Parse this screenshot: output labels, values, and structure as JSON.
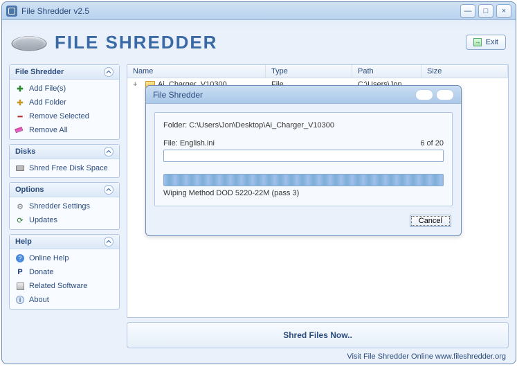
{
  "window": {
    "title": "File Shredder v2.5"
  },
  "header": {
    "logo_text": "FILE SHREDDER",
    "exit_label": "Exit"
  },
  "titlecontrols": {
    "min": "—",
    "max": "□",
    "close": "×"
  },
  "sidebar": {
    "sections": [
      {
        "title": "File Shredder",
        "items": [
          "Add File(s)",
          "Add Folder",
          "Remove Selected",
          "Remove All"
        ]
      },
      {
        "title": "Disks",
        "items": [
          "Shred Free Disk Space"
        ]
      },
      {
        "title": "Options",
        "items": [
          "Shredder Settings",
          "Updates"
        ]
      },
      {
        "title": "Help",
        "items": [
          "Online Help",
          "Donate",
          "Related Software",
          "About"
        ]
      }
    ]
  },
  "list": {
    "headers": {
      "name": "Name",
      "type": "Type",
      "path": "Path",
      "size": "Size"
    },
    "rows": [
      {
        "expand": "+",
        "name": "Ai_Charger_V10300",
        "type": "File",
        "path": "C:\\Users\\Jon",
        "size": ""
      }
    ]
  },
  "shred_button": "Shred Files Now..",
  "footer": "Visit File Shredder Online   www.fileshredder.org",
  "dialog": {
    "title": "File Shredder",
    "folder_label": "Folder: C:\\Users\\Jon\\Desktop\\Ai_Charger_V10300",
    "file_label": "File: English.ini",
    "progress_text": "6  of  20",
    "method": "Wiping Method DOD 5220-22M  (pass 3)",
    "cancel": "Cancel"
  }
}
